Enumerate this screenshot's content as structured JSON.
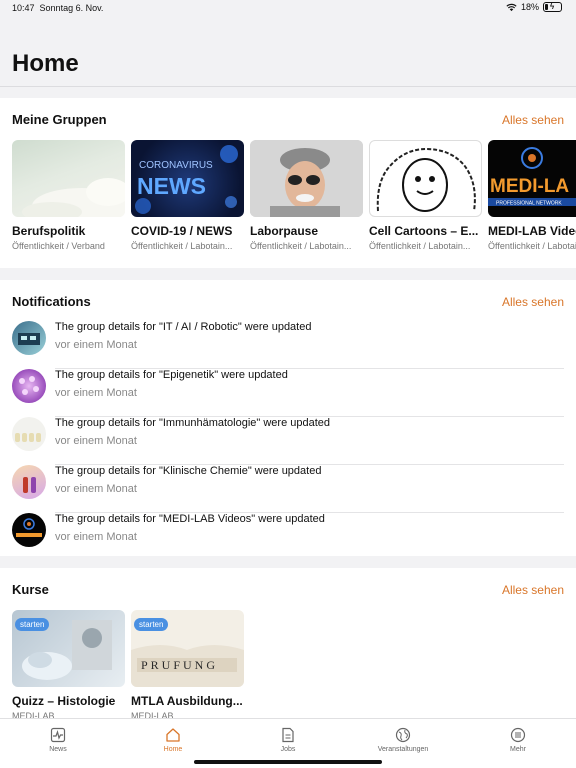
{
  "status": {
    "time": "10:47",
    "date": "Sonntag 6. Nov.",
    "battery": "18%",
    "battery_level": 0.18
  },
  "page": {
    "title": "Home"
  },
  "groups": {
    "title": "Meine Gruppen",
    "see_all": "Alles sehen",
    "items": [
      {
        "name": "Berufspolitik",
        "sub": "Öffentlichkeit / Verband",
        "image_text": ""
      },
      {
        "name": "COVID-19 / NEWS",
        "sub": "Öffentlichkeit / Labotain...",
        "image_text": "CORONAVIRUS NEWS"
      },
      {
        "name": "Laborpause",
        "sub": "Öffentlichkeit / Labotain...",
        "image_text": ""
      },
      {
        "name": "Cell Cartoons – E...",
        "sub": "Öffentlichkeit / Labotain...",
        "image_text": ""
      },
      {
        "name": "MEDI-LAB Videos",
        "sub": "Öffentlichkeit / Labotai",
        "image_text": "MEDI-LAB PROFESSIONAL NETWORK"
      }
    ]
  },
  "notifications": {
    "title": "Notifications",
    "see_all": "Alles sehen",
    "items": [
      {
        "text": "The group details for \"IT / AI / Robotic\" were updated",
        "time": "vor einem Monat"
      },
      {
        "text": "The group details for \"Epigenetik\" were updated",
        "time": "vor einem Monat"
      },
      {
        "text": "The group details for \"Immunhämatologie\" were updated",
        "time": "vor einem Monat"
      },
      {
        "text": "The group details for \"Klinische Chemie\" were updated",
        "time": "vor einem Monat"
      },
      {
        "text": "The group details for \"MEDI-LAB Videos\" were updated",
        "time": "vor einem Monat"
      }
    ]
  },
  "courses": {
    "title": "Kurse",
    "see_all": "Alles sehen",
    "items": [
      {
        "name": "Quizz – Histologie",
        "sub": "MEDI-LAB",
        "badge": "starten",
        "image_text": ""
      },
      {
        "name": "MTLA Ausbildung...",
        "sub": "MEDI-LAB",
        "badge": "starten",
        "image_text": "PRUFUNG"
      }
    ]
  },
  "tabs": [
    {
      "label": "News",
      "icon": "activity-icon"
    },
    {
      "label": "Home",
      "icon": "home-icon",
      "active": true
    },
    {
      "label": "Jobs",
      "icon": "document-icon"
    },
    {
      "label": "Veranstaltungen",
      "icon": "globe-icon"
    },
    {
      "label": "Mehr",
      "icon": "menu-icon"
    }
  ],
  "colors": {
    "accent": "#d9762a",
    "badge": "#4a90e2",
    "background": "#f2f2f4"
  }
}
